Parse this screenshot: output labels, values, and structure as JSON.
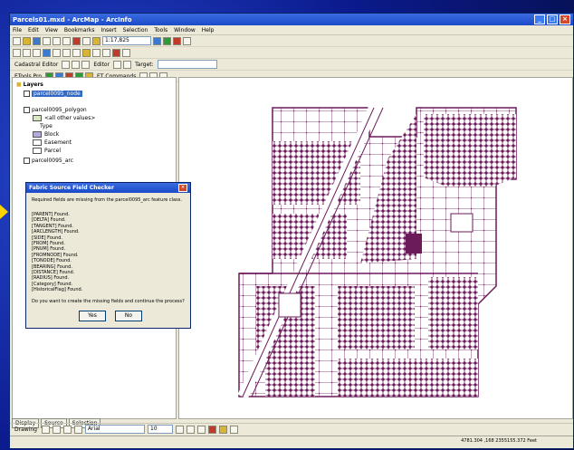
{
  "window": {
    "title": "Parcels01.mxd - ArcMap - ArcInfo"
  },
  "menu": [
    "File",
    "Edit",
    "View",
    "Bookmarks",
    "Insert",
    "Selection",
    "Tools",
    "Window",
    "Help"
  ],
  "toolbar": {
    "scale": "1:17,825",
    "editor_label": "Cadastral Editor",
    "target_label": "Target:",
    "commands_label": "ET Commands",
    "etools_label": "ETools Pro",
    "editor_menu": "Editor"
  },
  "toc": {
    "root": "Layers",
    "layers": [
      {
        "name": "parcel0095_node",
        "selected": true
      },
      {
        "name": "parcel0095_polygon",
        "selected": false
      },
      {
        "name": "parcel0095_arc",
        "selected": false
      }
    ],
    "legend_items": [
      "<all other values>",
      "Type",
      "Block",
      "Easement",
      "Parcel"
    ],
    "tabs": [
      "Display",
      "Source",
      "Selection"
    ]
  },
  "dialog": {
    "title": "Fabric Source Field Checker",
    "message": "Required fields are missing from the parcel0095_arc feature class.",
    "fields": [
      "[PARENT] Found.",
      "[DELTA] Found.",
      "[TANGENT] Found.",
      "[ARCLENGTH] Found.",
      "[SIDE] Found.",
      "[FROM] Found.",
      "[PNUM] Found.",
      "[FROMNODE] Found.",
      "[TONODE] Found.",
      "[BEARING] Found.",
      "[DISTANCE] Found.",
      "[RADIUS] Found.",
      "[Category] Found.",
      "[HistoricalFlag] Found."
    ],
    "question": "Do you want to create the missing fields and continue the process?",
    "yes": "Yes",
    "no": "No"
  },
  "drawing": {
    "label": "Drawing",
    "font": "Arial",
    "size": "10"
  },
  "status": {
    "coords": "4781.304 ,168  2355155.372 Feet"
  },
  "colors": {
    "parcels": "#6b1a5a",
    "titlebar": "#1a4ac8",
    "background": "#0a1a8a"
  }
}
